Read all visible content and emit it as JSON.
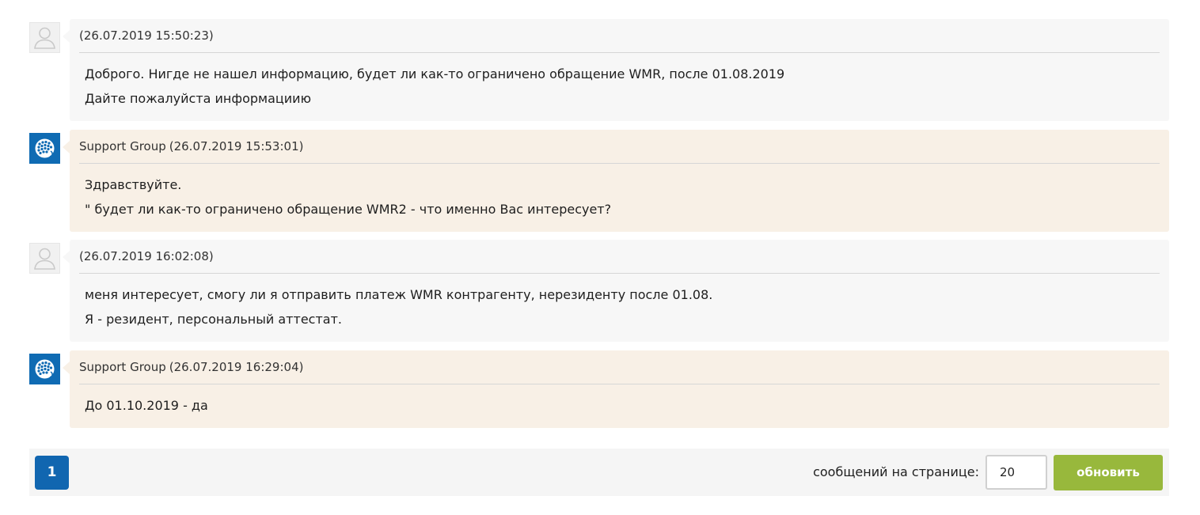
{
  "messages": [
    {
      "kind": "user",
      "author": "",
      "timestamp": "(26.07.2019 15:50:23)",
      "lines": [
        "Доброго. Нигде не нашел информацию, будет ли как-то ограничено обращение WMR, после 01.08.2019",
        "Дайте пожалуйста информациию"
      ]
    },
    {
      "kind": "support",
      "author": "Support Group",
      "timestamp": "(26.07.2019 15:53:01)",
      "lines": [
        "Здравствуйте.",
        "\" будет ли как-то ограничено обращение WMR2 - что именно Вас интересует?"
      ]
    },
    {
      "kind": "user",
      "author": "",
      "timestamp": "(26.07.2019 16:02:08)",
      "lines": [
        "меня интересует, смогу ли я отправить платеж WMR контрагенту, нерезиденту после 01.08.",
        "Я - резидент, персональный аттестат."
      ]
    },
    {
      "kind": "support",
      "author": "Support Group",
      "timestamp": "(26.07.2019 16:29:04)",
      "lines": [
        "До 01.10.2019 - да"
      ]
    }
  ],
  "pagination": {
    "current_page": "1",
    "per_page_label": "сообщений на странице:",
    "per_page_value": "20",
    "refresh_label": "обновить"
  },
  "colors": {
    "user_bubble": "#f7f7f7",
    "support_bubble": "#f8f0e6",
    "support_avatar": "#0f6bb3",
    "page_button": "#1166b0",
    "refresh_button": "#98b83c"
  },
  "icons": {
    "user_avatar": "user-silhouette-icon",
    "support_avatar": "webmoney-globe-icon"
  }
}
